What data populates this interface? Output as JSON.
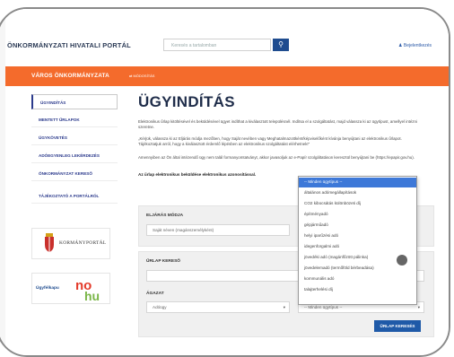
{
  "header": {
    "portal_title": "ÖNKORMÁNYZATI HIVATALI PORTÁL",
    "search_placeholder": "Keresés a tartalomban",
    "search_icon": "search-icon",
    "login_label": "Bejelentkezés"
  },
  "city_bar": {
    "city_name": "VÁROS ÖNKORMÁNYZATA",
    "change_label": "MÓDOSÍTÁS",
    "color": "#f46b2c"
  },
  "sidebar": {
    "items": [
      {
        "label": "ÜGYINDÍTÁS",
        "active": true
      },
      {
        "label": "MENTETT ŰRLAPOK",
        "active": false
      },
      {
        "label": "ÜGYKÖVETÉS",
        "active": false
      },
      {
        "label": "ADÓEGYENLEG LEKÉRDEZÉS",
        "active": false
      },
      {
        "label": "ÖNKORMÁNYZAT KERESŐ",
        "active": false
      },
      {
        "label": "TÁJÉKOZTATÓ A PORTÁLRÓL",
        "active": false
      }
    ],
    "logos": [
      {
        "label": "KORMÁNYPORTÁL"
      },
      {
        "label": "Ügyfélkapu",
        "mark": "no hu"
      }
    ]
  },
  "main": {
    "title": "ÜGYINDÍTÁS",
    "paragraphs": [
      "Elektronikus űrlap kitöltésével és beküldésével ügyet indíthat a kiválasztott településnél. Indítsa el a szolgáltatást, majd válassza ki az ügytípust, amellyel intézni szeretne.",
      "„Kérjük, válassza ki az Eljárás módja mezőben, hogy Saját nevében vagy Meghatalmazottként/képviselőként kívánja benyújtani az elektronikus űrlapot. Tájékoztatjuk arról, hogy a kiválasztott érdemlő lépésben az elektronikus szolgáltatást elérhetnek!\"",
      "Amennyiben az Ön által intézendő ügy nem talál formanyomtatványt, akkor javasoljuk az e-Papír szolgáltatáson keresztül benyújtani be (https://epapir.gov.hu)."
    ],
    "bold_line": "Az űrlap elektronikus beküldése elektronikus azonosítással.",
    "procedure": {
      "label": "ELJÁRÁS MÓDJA",
      "value": "Saját néven (magánszemélyként)"
    },
    "form_search": {
      "label": "ŰRLAP KERESŐ",
      "input_value": "",
      "branch_label": "ÁGAZAT",
      "branch_value": "Adóügy",
      "case_type_value": "-- Minden ügytípus --",
      "button_label": "ŰRLAP KERESÉS"
    }
  },
  "dropdown": {
    "options": [
      "-- Minden ügytípus --",
      "általános adómegállapítások",
      "CO2 kibocsátás különbözeti díj",
      "építményadó",
      "gépjárműadó",
      "helyi iparűzési adó",
      "idegenforgalmi adó",
      "jövedéki adó (magánfőzött pálinka)",
      "jövedelemadó (termőföld bérbeadása)",
      "kommunális adó",
      "talajterhelési díj"
    ],
    "selected_index": 0,
    "highlight_color": "#3d78d8"
  }
}
